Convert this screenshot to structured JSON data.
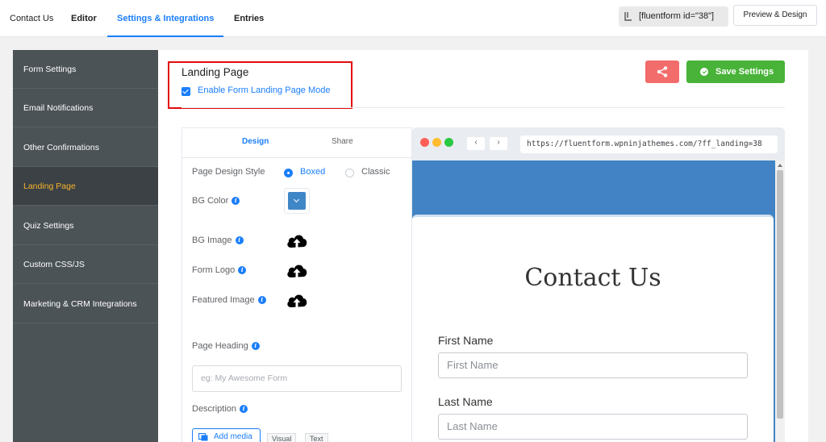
{
  "nav": {
    "tabs": [
      "Contact Us",
      "Editor",
      "Settings & Integrations",
      "Entries"
    ],
    "shortcode": "[fluentform id=\"38\"]",
    "preview_label": "Preview & Design"
  },
  "sidebar": {
    "items": [
      {
        "label": "Form Settings"
      },
      {
        "label": "Email Notifications"
      },
      {
        "label": "Other Confirmations"
      },
      {
        "label": "Landing Page"
      },
      {
        "label": "Quiz Settings"
      },
      {
        "label": "Custom CSS/JS"
      },
      {
        "label": "Marketing & CRM Integrations"
      }
    ],
    "active": "Landing Page"
  },
  "landing": {
    "title": "Landing Page",
    "enable_label": "Enable Form Landing Page Mode",
    "enable_checked": true,
    "save_label": "Save Settings"
  },
  "design_panel": {
    "tabs": [
      "Design",
      "Share"
    ],
    "page_design_style_label": "Page Design Style",
    "style_options": [
      "Boxed",
      "Classic"
    ],
    "style_selected": "Boxed",
    "bg_color_label": "BG Color",
    "bg_color_value": "#3f86c7",
    "bg_image_label": "BG Image",
    "form_logo_label": "Form Logo",
    "featured_image_label": "Featured Image",
    "page_heading_label": "Page Heading",
    "page_heading_placeholder": "eg: My Awesome Form",
    "description_label": "Description",
    "add_media_label": "Add media",
    "editor_tabs": [
      "Visual",
      "Text"
    ]
  },
  "preview": {
    "url": "https://fluentform.wpninjathemes.com/?ff_landing=38",
    "form_title": "Contact Us",
    "fields": [
      {
        "label": "First Name",
        "placeholder": "First Name"
      },
      {
        "label": "Last Name",
        "placeholder": "Last Name"
      }
    ]
  },
  "colors": {
    "accent": "#1a7efb",
    "sidebar_bg": "#4c5357",
    "sidebar_active_text": "#f7b32b",
    "save_green": "#48b338",
    "share_red": "#f36c6c",
    "highlight_red": "#e40b0b",
    "landing_bg": "#4183c4"
  }
}
